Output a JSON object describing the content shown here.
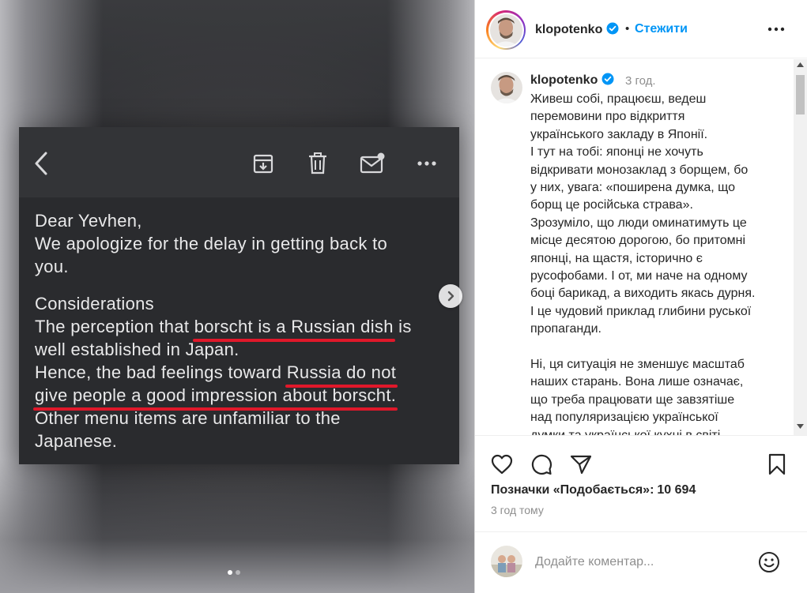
{
  "post": {
    "email": {
      "lines_a": [
        "Dear  Yevhen,",
        "We apologize for the delay in getting back to",
        "you."
      ],
      "considerations_label": "Considerations",
      "perception_pre": "The perception that ",
      "perception_hl": "borscht is a Russian dish",
      "perception_post": " is",
      "line_japan": "well established in Japan.",
      "hence_pre": "Hence, the bad feelings toward ",
      "hence_hl1": "Russia do not",
      "hence_hl2": "give people a good impression about borscht.",
      "other_1": "Other menu items are unfamiliar to the",
      "other_2": "Japanese."
    },
    "carousel": {
      "current": 1,
      "total": 2
    }
  },
  "header": {
    "username": "klopotenko",
    "bullet": "•",
    "follow_label": "Стежити"
  },
  "caption": {
    "username": "klopotenko",
    "time": "3 год.",
    "lines": [
      "Живеш собі, працюєш, ведеш",
      "перемовини про відкриття",
      "українського закладу в Японії.",
      "І тут на тобі: японці не хочуть",
      "відкривати монозаклад з борщем, бо",
      "у них, увага: «поширена думка, що",
      "борщ це російська страва».",
      "Зрозуміло, що люди оминатимуть це",
      "місце десятою дорогою, бо притомні",
      "японці, на щастя, історично є",
      "русофобами. І от, ми наче на одному",
      "боці барикад, а виходить якась дурня.",
      "І це чудовий приклад глибини руської",
      "пропаганди."
    ],
    "lines2": [
      "Ні, ця ситуація не зменшує масштаб",
      "наших старань. Вона лише означає,",
      "що треба працювати ще завзятіше",
      "над популяризацією української",
      "думки та української кухні в світі."
    ]
  },
  "stats": {
    "likes_label": "Позначки «Подобається»:",
    "likes_count": "10 694",
    "time_ago": "3 год тому"
  },
  "comment_box": {
    "placeholder": "Додайте коментар..."
  },
  "colors": {
    "accent": "#0095f6",
    "underline_red": "#e0182a",
    "email_bg": "#2a2b2e"
  },
  "icons": [
    "back-icon",
    "archive-icon",
    "trash-icon",
    "mail-icon",
    "more-icon",
    "chevron-right-icon",
    "heart-icon",
    "comment-icon",
    "share-icon",
    "bookmark-icon",
    "emoji-icon",
    "verified-icon"
  ]
}
